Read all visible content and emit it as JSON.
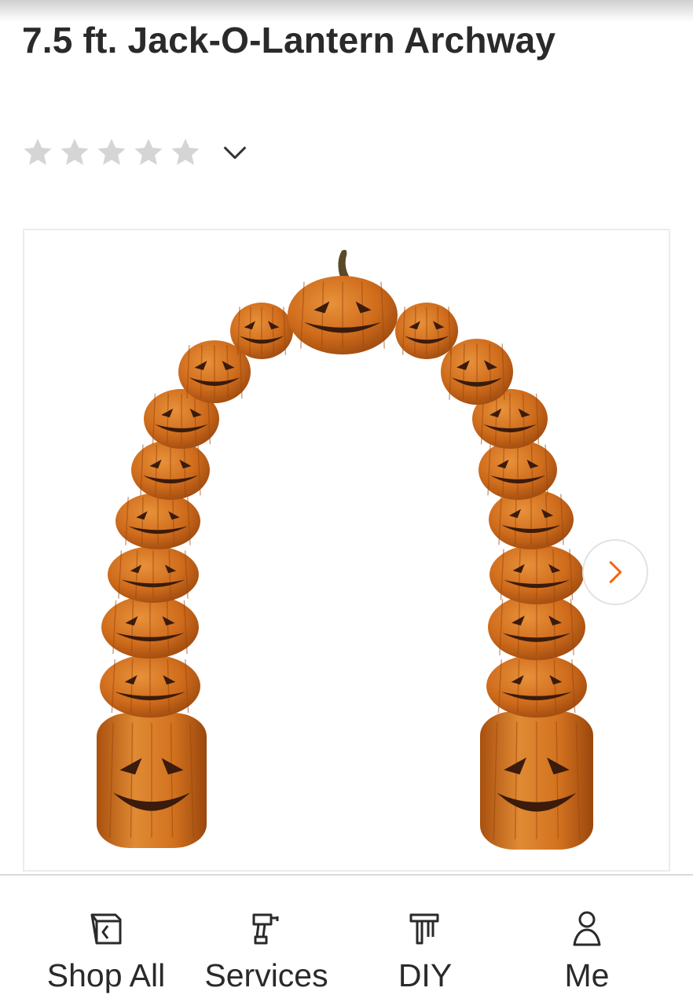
{
  "product": {
    "title": "7.5 ft. Jack-O-Lantern Archway",
    "rating": {
      "stars": 0,
      "max_stars": 5
    }
  },
  "gallery": {
    "next_icon": "chevron-right-icon"
  },
  "bottom_nav": {
    "items": [
      {
        "label": "Shop All",
        "icon": "catalog-tag-icon"
      },
      {
        "label": "Services",
        "icon": "drill-icon"
      },
      {
        "label": "DIY",
        "icon": "hammer-icon"
      },
      {
        "label": "Me",
        "icon": "user-icon"
      }
    ]
  },
  "colors": {
    "pumpkin": "#d4761f",
    "pumpkin_dark": "#a9500e",
    "face": "#3a1b0c",
    "star_gray": "#d5d5d5",
    "accent": "#f96302"
  }
}
